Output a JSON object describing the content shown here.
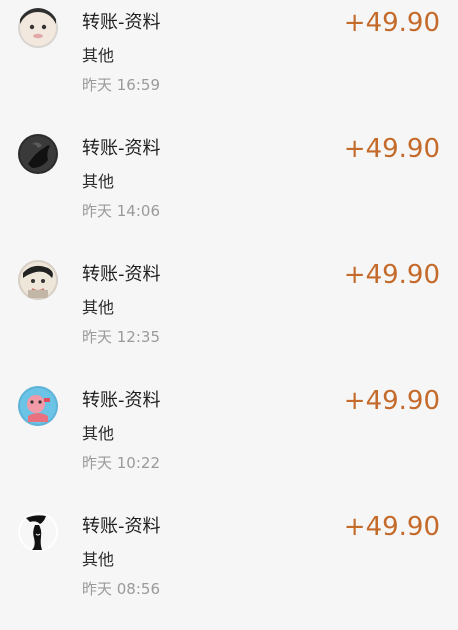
{
  "colors": {
    "background": "#f6f6f6",
    "amount": "#c46a2a",
    "title": "#1f1f1f",
    "subtitle": "#2d2d2d",
    "time": "#9a9a9a"
  },
  "transactions": [
    {
      "avatar_icon": "child-avatar-icon",
      "title": "转账-资料",
      "category": "其他",
      "time": "昨天 16:59",
      "amount": "+49.90"
    },
    {
      "avatar_icon": "dark-silhouette-avatar-icon",
      "title": "转账-资料",
      "category": "其他",
      "time": "昨天 14:06",
      "amount": "+49.90"
    },
    {
      "avatar_icon": "baby-avatar-icon",
      "title": "转账-资料",
      "category": "其他",
      "time": "昨天 12:35",
      "amount": "+49.90"
    },
    {
      "avatar_icon": "cartoon-avatar-icon",
      "title": "转账-资料",
      "category": "其他",
      "time": "昨天 10:22",
      "amount": "+49.90"
    },
    {
      "avatar_icon": "black-white-avatar-icon",
      "title": "转账-资料",
      "category": "其他",
      "time": "昨天 08:56",
      "amount": "+49.90"
    }
  ]
}
